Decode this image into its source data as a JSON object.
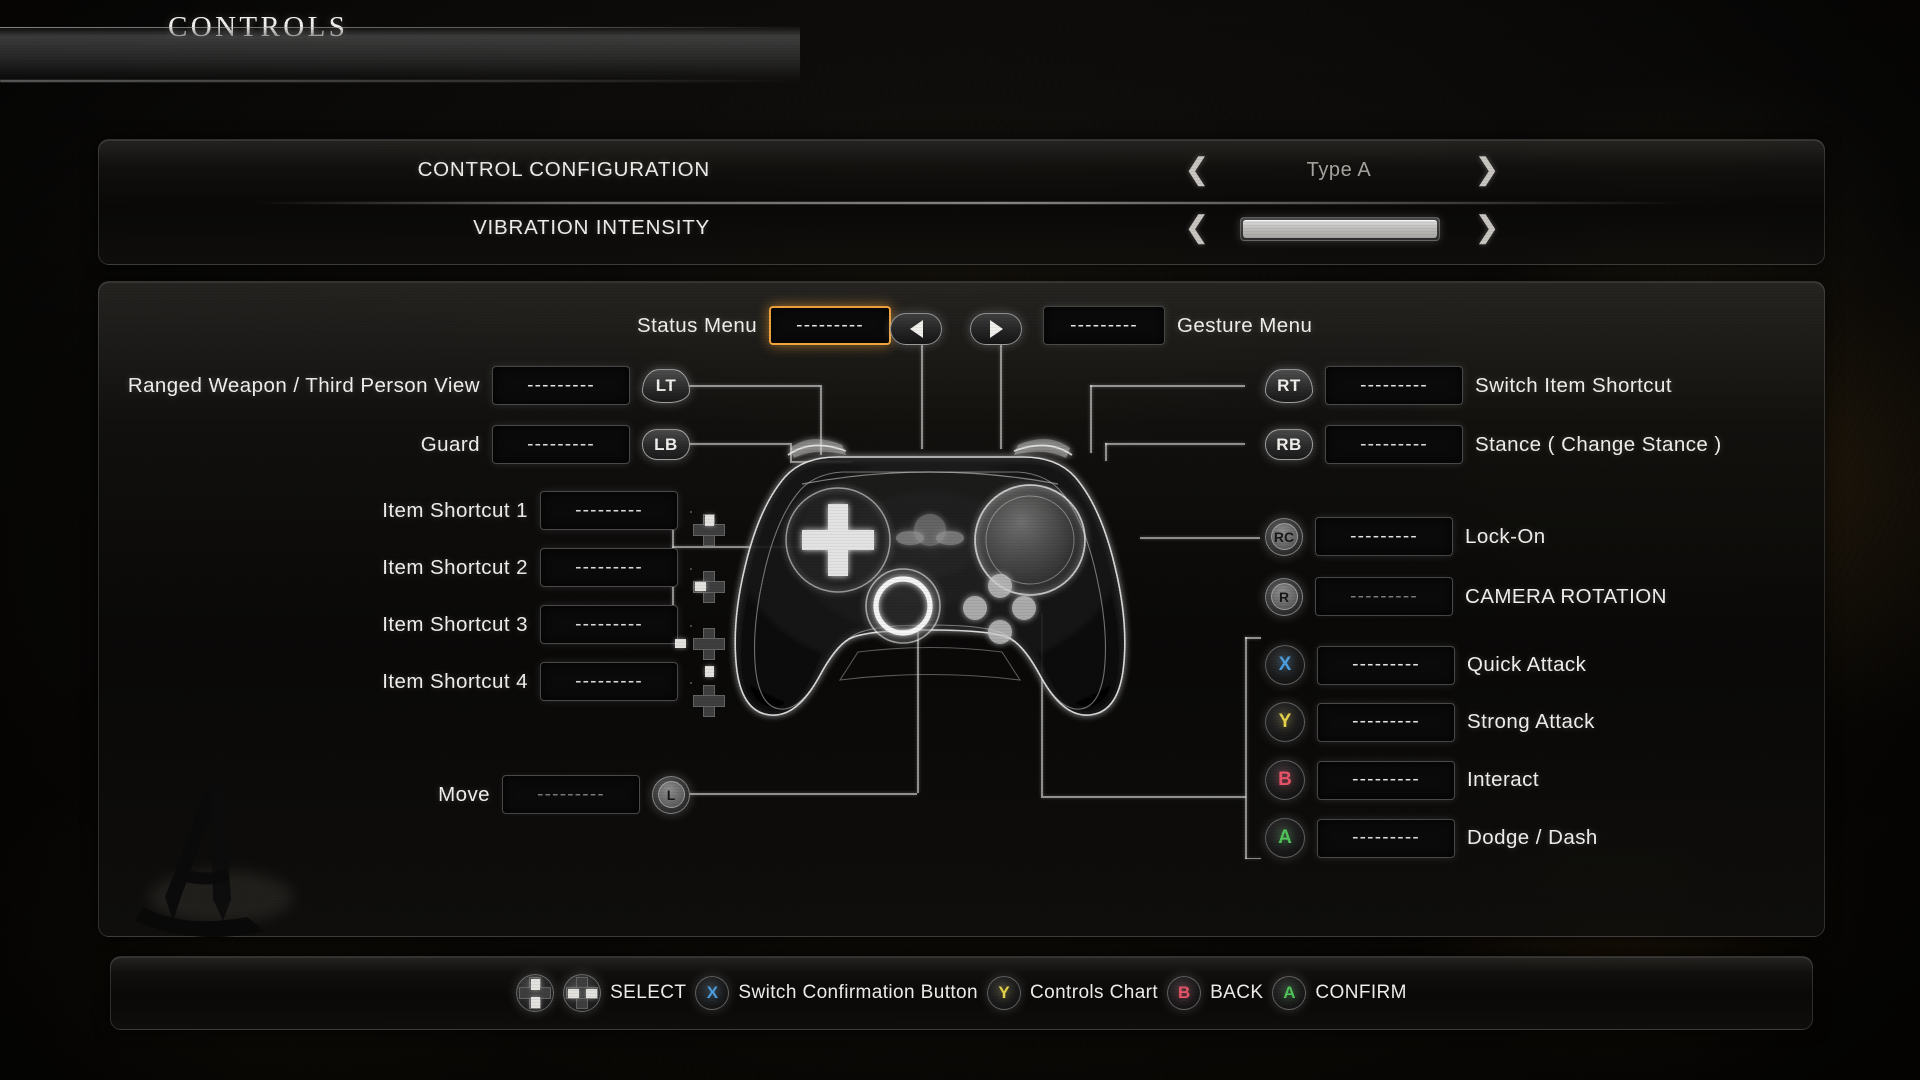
{
  "page": {
    "title": "CONTROLS",
    "watermark": "A"
  },
  "config_panel": {
    "rows": [
      {
        "label": "CONTROL CONFIGURATION",
        "type": "selector",
        "value": "Type A",
        "prev_icon": "chevron-left-icon",
        "next_icon": "chevron-right-icon"
      },
      {
        "label": "VIBRATION INTENSITY",
        "type": "slider",
        "value": "100",
        "prev_icon": "chevron-left-icon",
        "next_icon": "chevron-right-icon"
      }
    ]
  },
  "placeholder_binding": "---------",
  "menu_row": {
    "status_label": "Status Menu",
    "status_value": "---------",
    "status_selected": true,
    "left_button_icon": "triangle-left-icon",
    "right_button_icon": "triangle-right-icon",
    "gesture_value": "---------",
    "gesture_label": "Gesture Menu"
  },
  "left_bindings": [
    {
      "label": "Ranged Weapon / Third Person View",
      "value": "---------",
      "button": "LT",
      "button_style": "trigger",
      "dim": false
    },
    {
      "label": "Guard",
      "value": "---------",
      "button": "LB",
      "button_style": "pill",
      "dim": false
    },
    {
      "label": "Item Shortcut 1",
      "value": "---------",
      "button": "dpad-up",
      "button_style": "dpad",
      "dim": false
    },
    {
      "label": "Item Shortcut 2",
      "value": "---------",
      "button": "dpad-left",
      "button_style": "dpad",
      "dim": false
    },
    {
      "label": "Item Shortcut 3",
      "value": "---------",
      "button": "dpad-right",
      "button_style": "dpad",
      "dim": false
    },
    {
      "label": "Item Shortcut 4",
      "value": "---------",
      "button": "dpad-down",
      "button_style": "dpad",
      "dim": false
    },
    {
      "label": "Move",
      "value": "---------",
      "button": "L",
      "button_style": "stick",
      "dim": true
    }
  ],
  "right_bindings": [
    {
      "button": "RT",
      "button_style": "trigger",
      "value": "---------",
      "label": "Switch Item Shortcut",
      "dim": false,
      "color": ""
    },
    {
      "button": "RB",
      "button_style": "pill",
      "value": "---------",
      "label": "Stance ( Change Stance )",
      "dim": false,
      "color": ""
    },
    {
      "button": "RC",
      "button_style": "stick",
      "value": "---------",
      "label": "Lock-On",
      "dim": false,
      "color": ""
    },
    {
      "button": "R",
      "button_style": "stick",
      "value": "---------",
      "label": "CAMERA ROTATION",
      "dim": true,
      "color": ""
    },
    {
      "button": "X",
      "button_style": "face",
      "value": "---------",
      "label": "Quick Attack",
      "dim": false,
      "color": "#4d9fe0"
    },
    {
      "button": "Y",
      "button_style": "face",
      "value": "---------",
      "label": "Strong Attack",
      "dim": false,
      "color": "#e8d44a"
    },
    {
      "button": "B",
      "button_style": "face",
      "value": "---------",
      "label": "Interact",
      "dim": false,
      "color": "#e8556a"
    },
    {
      "button": "A",
      "button_style": "face",
      "value": "---------",
      "label": "Dodge / Dash",
      "dim": false,
      "color": "#52c45c"
    }
  ],
  "legend": [
    {
      "icon": "dpad-vertical-icon",
      "color": ""
    },
    {
      "icon": "dpad-horizontal-icon",
      "color": ""
    },
    {
      "text": "SELECT"
    },
    {
      "icon": "face-button-x-icon",
      "glyph": "X",
      "color": "#4d9fe0"
    },
    {
      "text": "Switch Confirmation Button"
    },
    {
      "icon": "face-button-y-icon",
      "glyph": "Y",
      "color": "#e8d44a"
    },
    {
      "text": "Controls Chart"
    },
    {
      "icon": "face-button-b-icon",
      "glyph": "B",
      "color": "#e8556a"
    },
    {
      "text": "BACK"
    },
    {
      "icon": "face-button-a-icon",
      "glyph": "A",
      "color": "#52c45c"
    },
    {
      "text": "CONFIRM"
    }
  ],
  "colors": {
    "accent_selected": "#f0a33c",
    "text_primary": "#f2f0ed",
    "text_dim": "#7c7a76",
    "button_x": "#4d9fe0",
    "button_y": "#e8d44a",
    "button_b": "#e8556a",
    "button_a": "#52c45c"
  }
}
